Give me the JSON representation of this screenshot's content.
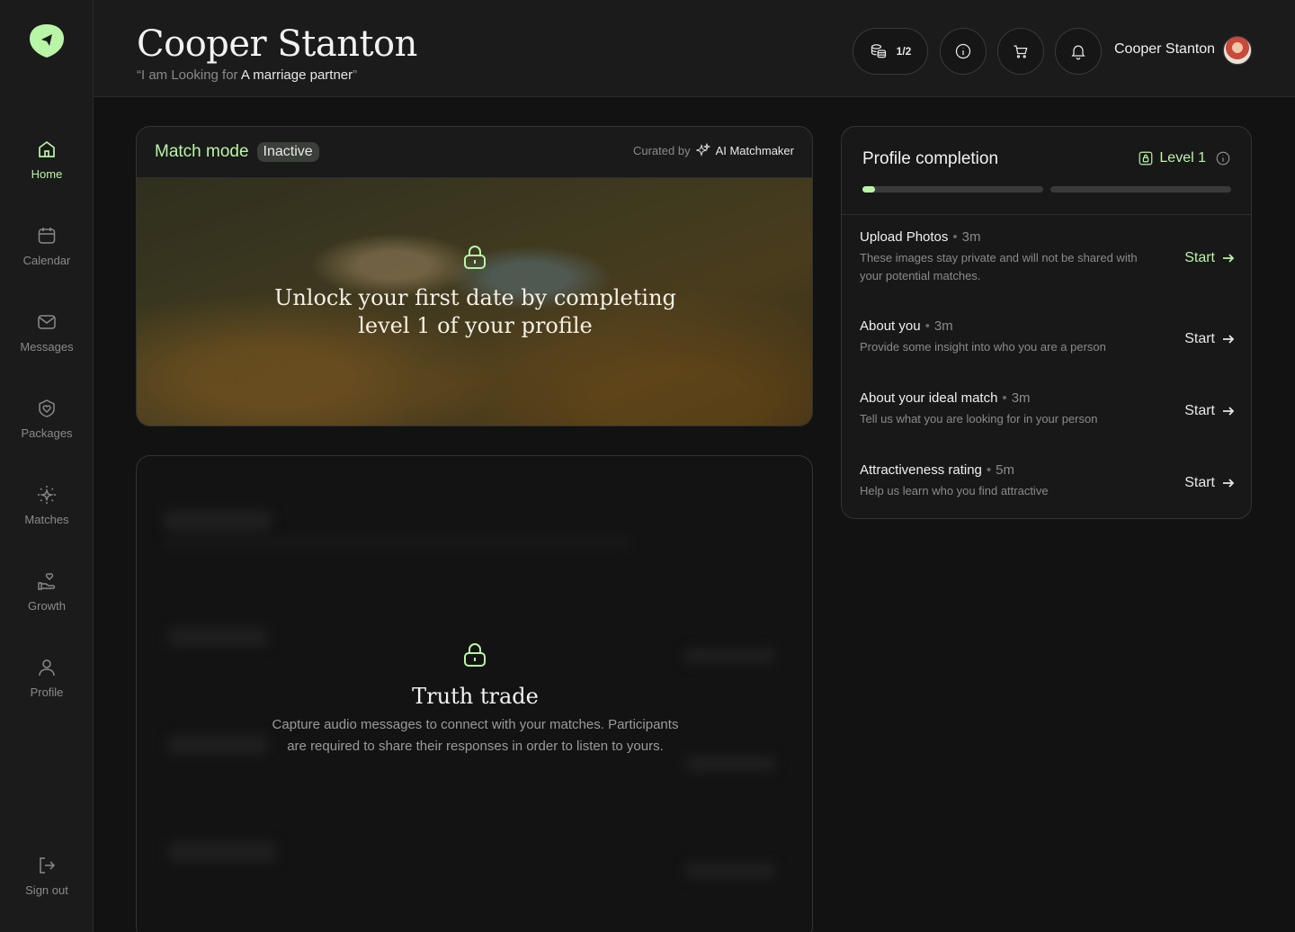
{
  "sidebar": {
    "logo_name": "brand-logo",
    "items": [
      {
        "label": "Home",
        "icon": "home-icon"
      },
      {
        "label": "Calendar",
        "icon": "calendar-icon"
      },
      {
        "label": "Messages",
        "icon": "mail-icon"
      },
      {
        "label": "Packages",
        "icon": "shield-heart-icon"
      },
      {
        "label": "Matches",
        "icon": "sparkle-icon"
      },
      {
        "label": "Growth",
        "icon": "hand-heart-icon"
      },
      {
        "label": "Profile",
        "icon": "user-icon"
      }
    ],
    "signout": {
      "label": "Sign out",
      "icon": "sign-out-icon"
    }
  },
  "header": {
    "title": "Cooper Stanton",
    "subtitle_prefix": "“I am Looking for ",
    "subtitle_value": "A marriage partner",
    "subtitle_suffix": "”",
    "credits": "1/2",
    "user_name": "Cooper Stanton"
  },
  "match_card": {
    "mode_label": "Match mode",
    "status_badge": "Inactive",
    "curated_prefix": "Curated by",
    "curated_by": "AI Matchmaker",
    "unlock_line1": "Unlock your first date by completing",
    "unlock_line2": "level 1 of your profile"
  },
  "truth_card": {
    "title": "Truth trade",
    "desc_line1": "Capture audio messages to connect with your matches. Participants",
    "desc_line2": "are required to share their responses in order to listen to yours."
  },
  "profile_completion": {
    "title": "Profile completion",
    "level": "Level 1",
    "progress": [
      0.07,
      0
    ],
    "tasks": [
      {
        "title": "Upload Photos",
        "duration": "3m",
        "desc": "These images stay private and will not be shared with your potential matches.",
        "cta": "Start"
      },
      {
        "title": "About you",
        "duration": "3m",
        "desc": "Provide some insight into who you are a person",
        "cta": "Start"
      },
      {
        "title": "About your ideal match",
        "duration": "3m",
        "desc": "Tell us what you are looking for in your person",
        "cta": "Start"
      },
      {
        "title": "Attractiveness rating",
        "duration": "5m",
        "desc": "Help us learn who you find attractive",
        "cta": "Start"
      }
    ]
  },
  "colors": {
    "accent": "#b9f5a6",
    "background": "#121212",
    "panel": "#1b1b1b"
  }
}
